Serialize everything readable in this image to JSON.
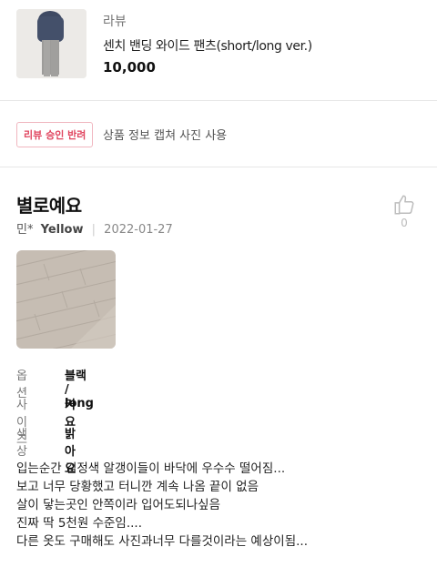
{
  "product": {
    "brand": "라뷰",
    "name": "센치 밴딩 와이드 팬츠(short/long ver.)",
    "price": "10,000"
  },
  "review_status": {
    "badge": "리뷰 승인 반려",
    "reason": "상품 정보 캡쳐 사진 사용",
    "badge_color": "#e0455f"
  },
  "review": {
    "title": "별로예요",
    "author": "민*",
    "level": "Yellow",
    "date": "2022-01-27",
    "like_icon": "thumbs-up-icon",
    "like_count": "0",
    "options": [
      {
        "label": "옵션",
        "value": "블랙 / long"
      },
      {
        "label": "사이즈",
        "value": "커요"
      },
      {
        "label": "색상",
        "value": "밝아요"
      }
    ],
    "body_lines": [
      "입는순간 검정색 알갱이들이 바닥에 우수수 떨어짐...",
      "보고 너무 당황했고 터니깐 계속 나옴 끝이 없음",
      "살이 닿는곳인 안쪽이라 입어도되나싶음",
      "진짜 딱 5천원 수준임....",
      "다른 옷도 구매해도 사진과너무 다를것이라는 예상이됨..."
    ]
  }
}
